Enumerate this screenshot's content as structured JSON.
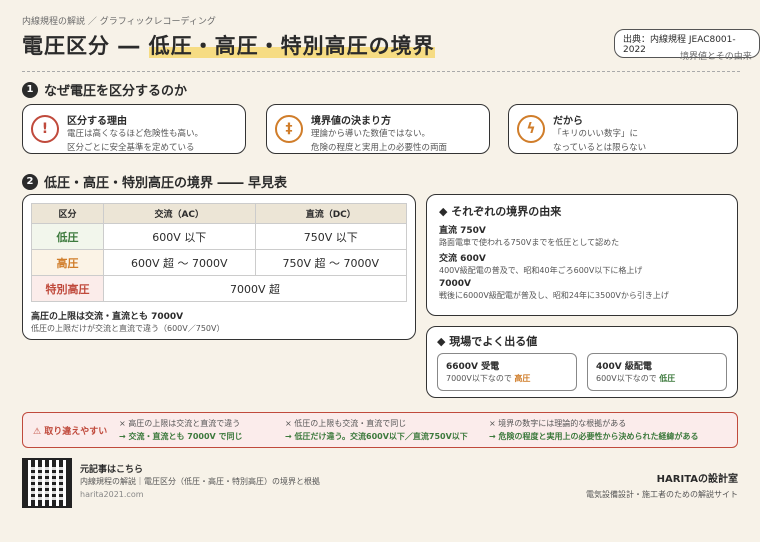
{
  "header": {
    "breadcrumb": "内線規程の解説 ／ グラフィックレコーディング",
    "title_prefix": "電圧区分 ― ",
    "title_highlight": "低圧・高圧・特別高圧の境界",
    "source": "出典：内線規程 JEAC8001-2022",
    "subtitle": "境界値とその由来"
  },
  "section1": {
    "num": "1",
    "title": "なぜ電圧を区分するのか",
    "cards": [
      {
        "icon": "!",
        "title": "区分する理由",
        "lines": [
          "電圧は高くなるほど危険性も高い。",
          "区分ごとに安全基準を定めている"
        ]
      },
      {
        "icon": "‡",
        "title": "境界値の決まり方",
        "lines": [
          "理論から導いた数値ではない。",
          "危険の程度と実用上の必要性の両面"
        ]
      },
      {
        "icon": "ϟ",
        "title": "だから",
        "lines": [
          "「キリのいい数字」に",
          "なっているとは限らない"
        ]
      }
    ]
  },
  "section2": {
    "num": "2",
    "title": "低圧・高圧・特別高圧の境界 ―― 早見表"
  },
  "table": {
    "headers": [
      "区分",
      "交流（AC）",
      "直流（DC）"
    ],
    "rows": [
      {
        "label": "低圧",
        "ac": "600V 以下",
        "dc": "750V 以下"
      },
      {
        "label": "高圧",
        "ac": "600V 超 〜 7000V",
        "dc": "750V 超 〜 7000V"
      },
      {
        "label": "特別高圧",
        "span": "7000V 超"
      }
    ],
    "note_title": "高圧の上限は交流・直流とも 7000V",
    "note_text": "低圧の上限だけが交流と直流で違う（600V／750V）"
  },
  "origin": {
    "title": "それぞれの境界の由来",
    "items": [
      {
        "head": "直流 750V",
        "text": "路面電車で使われる750Vまでを低圧として認めた"
      },
      {
        "head": "交流 600V",
        "text": "400V級配電の普及で、昭和40年ごろ600V以下に格上げ"
      },
      {
        "head": "7000V",
        "text": "戦後に6000V級配電が普及し、昭和24年に3500Vから引き上げ"
      }
    ]
  },
  "field": {
    "title": "現場でよく出る値",
    "items": [
      {
        "head": "6600V 受電",
        "pre": "7000V以下なので ",
        "val": "高圧"
      },
      {
        "head": "400V 級配電",
        "pre": "600V以下なので ",
        "val": "低圧"
      }
    ]
  },
  "mistakes": {
    "label": "取り違えやすい",
    "items": [
      {
        "wrong": "高圧の上限は交流と直流で違う",
        "right": "交流・直流とも 7000V で同じ"
      },
      {
        "wrong": "低圧の上限も交流・直流で同じ",
        "right": "低圧だけ違う。交流600V以下／直流750V以下"
      },
      {
        "wrong": "境界の数字には理論的な根拠がある",
        "right": "危険の程度と実用上の必要性から決められた経緯がある"
      }
    ]
  },
  "footer": {
    "qr_title": "元記事はこちら",
    "qr_text": "内線規程の解説｜電圧区分（低圧・高圧・特別高圧）の境界と根拠",
    "url": "harita2021.com",
    "brand": "HARITAの設計室",
    "brand_sub": "電気設備設計・施工者のための解説サイト"
  }
}
